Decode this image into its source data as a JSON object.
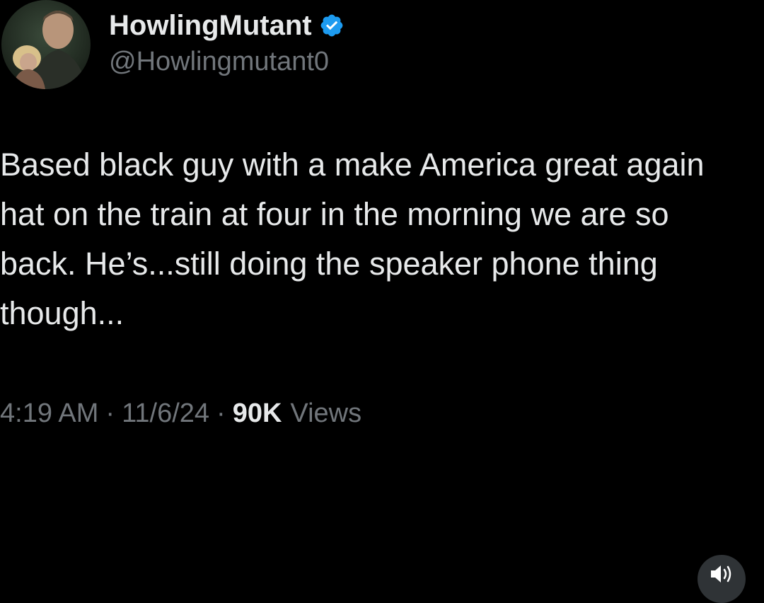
{
  "tweet": {
    "author": {
      "display_name": "HowlingMutant",
      "handle": "@Howlingmutant0",
      "verified_icon": "verified-badge-icon",
      "avatar": "profile-avatar"
    },
    "text": "Based black guy with a make America great again\nhat on the train at four in the morning we are so\nback.  He’s...still doing the speaker phone thing\nthough...",
    "time": "4:19 AM",
    "date": "11/6/24",
    "separator": "·",
    "views_count": "90K",
    "views_label": "Views"
  },
  "controls": {
    "sound_icon": "speaker-icon"
  },
  "colors": {
    "background": "#000000",
    "primary_text": "#e7e9ea",
    "secondary_text": "#71767b",
    "verified_blue": "#1d9bf0"
  }
}
